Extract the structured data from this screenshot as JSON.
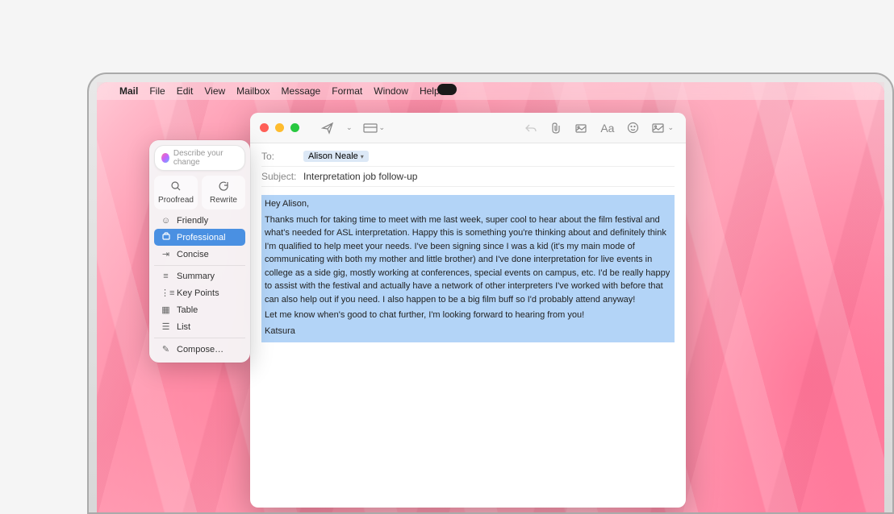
{
  "menubar": {
    "app": "Mail",
    "items": [
      "File",
      "Edit",
      "View",
      "Mailbox",
      "Message",
      "Format",
      "Window",
      "Help"
    ]
  },
  "mail": {
    "to_label": "To:",
    "recipient": "Alison Neale",
    "subject_label": "Subject:",
    "subject": "Interpretation job follow-up",
    "body": {
      "greeting": "Hey Alison,",
      "para1": "Thanks much for taking time to meet with me last week, super cool to hear about the film festival and what's needed for ASL interpretation. Happy this is something you're thinking about and definitely think I'm qualified to help meet your needs. I've been signing since I was a kid (it's my main mode of communicating with both my mother and little brother) and I've done interpretation for  live events in college as a side gig, mostly working at conferences, special events on campus, etc. I'd be really happy to assist with the festival and actually have a network of other interpreters I've worked with before that can also help out if you need. I also happen to be a big film buff so I'd probably attend anyway!",
      "para2": "Let me know when's good to chat further, I'm looking forward to hearing from you!",
      "signature": "Katsura"
    }
  },
  "ai_popover": {
    "input_placeholder": "Describe your change",
    "actions": {
      "proofread": "Proofread",
      "rewrite": "Rewrite"
    },
    "menu": {
      "friendly": "Friendly",
      "professional": "Professional",
      "concise": "Concise",
      "summary": "Summary",
      "keypoints": "Key Points",
      "table": "Table",
      "list": "List",
      "compose": "Compose…"
    }
  }
}
